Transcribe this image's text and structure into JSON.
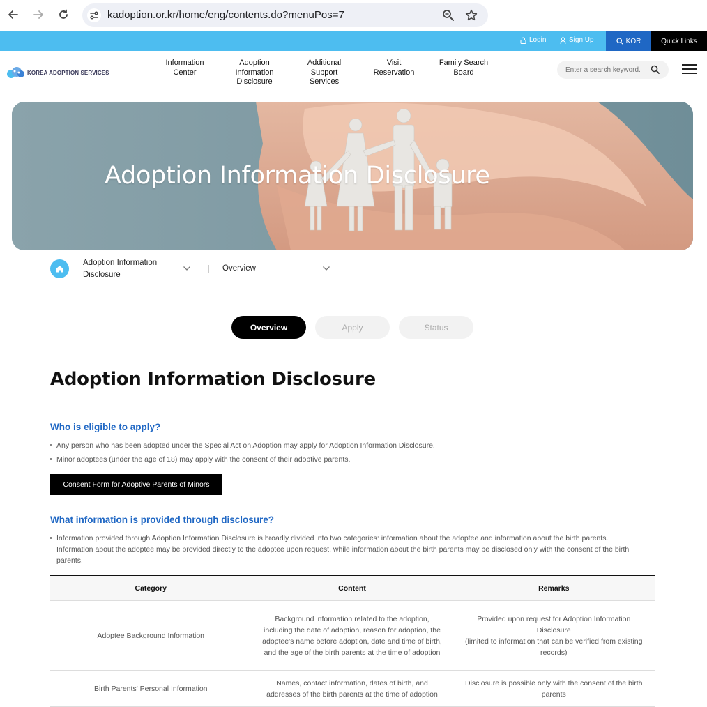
{
  "browser": {
    "url": "kadoption.or.kr/home/eng/contents.do?menuPos=7"
  },
  "utility": {
    "login": "Login",
    "signup": "Sign Up",
    "kor": "KOR",
    "quick_links": "Quick Links"
  },
  "header": {
    "logo_text": "KOREA ADOPTION SERVICES",
    "nav": [
      {
        "label": "Information\nCenter"
      },
      {
        "label": "Adoption\nInformation\nDisclosure"
      },
      {
        "label": "Additional\nSupport\nServices"
      },
      {
        "label": "Visit\nReservation"
      },
      {
        "label": "Family Search\nBoard"
      }
    ],
    "search_placeholder": "Enter a search keyword."
  },
  "hero": {
    "title": "Adoption Information Disclosure"
  },
  "breadcrumb": {
    "level1": "Adoption Information Disclosure",
    "level2": "Overview"
  },
  "tabs": [
    {
      "label": "Overview",
      "active": true
    },
    {
      "label": "Apply",
      "active": false
    },
    {
      "label": "Status",
      "active": false
    }
  ],
  "content": {
    "title": "Adoption Information Disclosure",
    "section1": {
      "heading": "Who is eligible to apply?",
      "bullets": [
        "Any person who has been adopted under the Special Act on Adoption may apply for Adoption Information Disclosure.",
        "Minor adoptees (under the age of 18) may apply with the consent of their adoptive parents."
      ],
      "button": "Consent Form for Adoptive Parents of Minors"
    },
    "section2": {
      "heading": "What information is provided through disclosure?",
      "bullet": "Information provided through Adoption Information Disclosure is broadly divided into two categories: information about the adoptee and information about the birth parents. Information about the adoptee may be provided directly to the adoptee upon request, while information about the birth parents may be disclosed only with the consent of the birth parents."
    },
    "table": {
      "headers": [
        "Category",
        "Content",
        "Remarks"
      ],
      "rows": [
        [
          "Adoptee Background Information",
          "Background information related to the adoption, including the date of adoption, reason for adoption, the adoptee's name before adoption, date and time of birth, and the age of the birth parents at the time of adoption",
          "Provided upon request for Adoption Information Disclosure\n(limited to information that can be verified from existing records)"
        ],
        [
          "Birth Parents' Personal Information",
          "Names, contact information, dates of birth, and addresses of the birth parents at the time of adoption",
          "Disclosure is possible only with the consent of the birth parents"
        ]
      ]
    }
  },
  "colors": {
    "utility_bar": "#4dbdf0",
    "kor_bg": "#1f67c4",
    "heading_blue": "#1f67c4"
  }
}
